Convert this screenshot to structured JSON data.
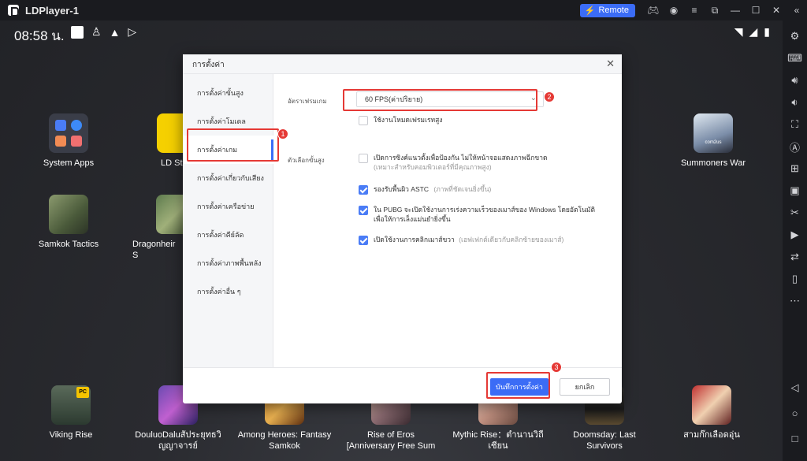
{
  "window": {
    "title": "LDPlayer-1",
    "remote_label": "Remote",
    "controls": [
      "gamepad-icon",
      "account-icon",
      "menu-icon",
      "popout-icon",
      "minimize-icon",
      "maximize-icon",
      "close-icon",
      "collapse-icon"
    ]
  },
  "status": {
    "time": "08:58 น."
  },
  "apps": {
    "system_apps": "System Apps",
    "ld_store": "LD Sto",
    "summoners_war": "Summoners War",
    "samkok_tactics": "Samkok Tactics",
    "dragonheir": "Dragonheir S",
    "viking_rise": "Viking Rise",
    "douluo_line1": "DouluoDaluสัประยุทธวิ",
    "douluo_line2": "ญญาจารย์",
    "among_heroes_line1": "Among Heroes: Fantasy",
    "among_heroes_line2": "Samkok",
    "rise_of_eros_line1": "Rise of Eros",
    "rise_of_eros_line2": "[Anniversary Free Sum",
    "mythic_rise_line1": "Mythic Rise：ตำนานวิถี",
    "mythic_rise_line2": "เซียน",
    "doomsday_line1": "Doomsday: Last",
    "doomsday_line2": "Survivors",
    "sam_kok": "สามก๊กเลือดอุ่น",
    "summoners_badge": "com2us",
    "viking_badge": "PC"
  },
  "dialog": {
    "title": "การตั้งค่า",
    "nav": [
      "การตั้งค่าขั้นสูง",
      "การตั้งค่าโมเดล",
      "การตั้งค่าเกม",
      "การตั้งค่าเกี่ยวกับเสียง",
      "การตั้งค่าเครือข่าย",
      "การตั้งค่าคีย์ลัด",
      "การตั้งค่าภาพพื้นหลัง",
      "การตั้งค่าอื่น ๆ"
    ],
    "active_nav_index": 2,
    "frame_rate_label": "อัตราเฟรมเกม",
    "frame_rate_value": "60 FPS(ค่าปริยาย)",
    "high_fps_mode": "ใช้งานโหมดเฟรมเรทสูง",
    "advanced_label": "ตัวเลือกขั้นสูง",
    "opt1_main": "เปิดการซิงค์แนวตั้งเพื่อป้องกัน ไม่ให้หน้าจอแสดงภาพฉีกขาด",
    "opt1_sub": "(เหมาะสำหรับคอมพิวเตอร์ที่มีคุณภาพสูง)",
    "opt2_main": "รองรับพื้นผิว ASTC",
    "opt2_sub": "(ภาพที่ชัดเจนยิ่งขึ้น)",
    "opt3_line1": "ใน PUBG จะเปิดใช้งานการเร่งความเร็วของเมาส์ของ Windows โดยอัตโนมัติ",
    "opt3_line2": "เพื่อให้การเล็งแม่นยำยิ่งขึ้น",
    "opt4_main": "เปิดใช้งานการคลิกเมาส์ขวา",
    "opt4_sub": "(เอฟเฟกต์เดียวกับคลิกซ้ายของเมาส์)",
    "checkboxes": {
      "high_fps": false,
      "vsync": false,
      "astc": true,
      "pubg_mouse": true,
      "right_click": true
    },
    "save_label": "บันทึกการตั้งค่า",
    "cancel_label": "ยกเลิก"
  },
  "annotations": {
    "badge1": "1",
    "badge2": "2",
    "badge3": "3"
  },
  "colors": {
    "accent": "#3b6cf6",
    "annotation": "#e53935"
  }
}
